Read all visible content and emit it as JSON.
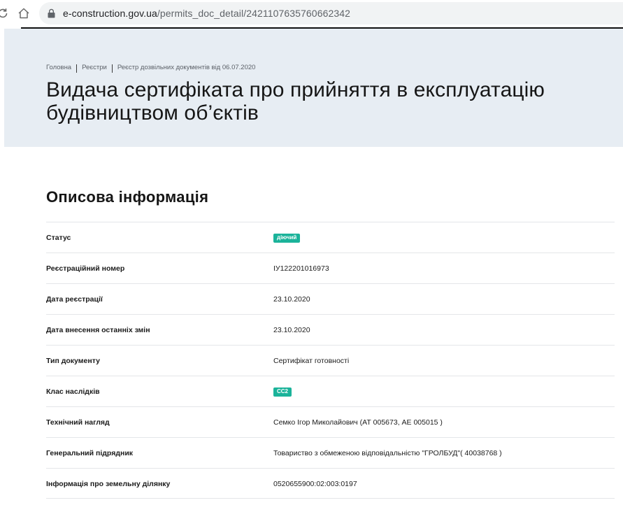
{
  "browser": {
    "url_domain": "e-construction.gov.ua",
    "url_path": "/permits_doc_detail/2421107635760662342"
  },
  "header": {
    "breadcrumb": [
      "Головна",
      "Реєстри",
      "Реєстр дозвільних документів від 06.07.2020"
    ],
    "title_line1": "Видача сертифіката про прийняття в експлуатацію",
    "title_line2": "будівництвом об’єктів"
  },
  "section": {
    "title": "Описова інформація"
  },
  "rows": [
    {
      "label": "Статус",
      "badge": "діючий",
      "badge_color": "#1bb39a"
    },
    {
      "label": "Реєстраційний номер",
      "value": "ІУ122201016973"
    },
    {
      "label": "Дата реєстрації",
      "value": "23.10.2020"
    },
    {
      "label": "Дата внесення останніх змін",
      "value": "23.10.2020"
    },
    {
      "label": "Тип документу",
      "value": "Сертифікат готовності"
    },
    {
      "label": "Клас наслідків",
      "badge": "СС2",
      "badge_color": "#1bb39a"
    },
    {
      "label": "Технічний нагляд",
      "value": "Семко Ігор Миколайович (АТ 005673, АЕ 005015 )"
    },
    {
      "label": "Генеральний підрядник",
      "value": "Товариство з обмеженою відповідальністю \"ГРОЛБУД\"( 40038768 )"
    },
    {
      "label": "Інформація про земельну ділянку",
      "value": "0520655900:02:003:0197"
    }
  ],
  "icons": {
    "reload": "reload-icon",
    "home": "home-icon",
    "lock": "lock-icon"
  }
}
